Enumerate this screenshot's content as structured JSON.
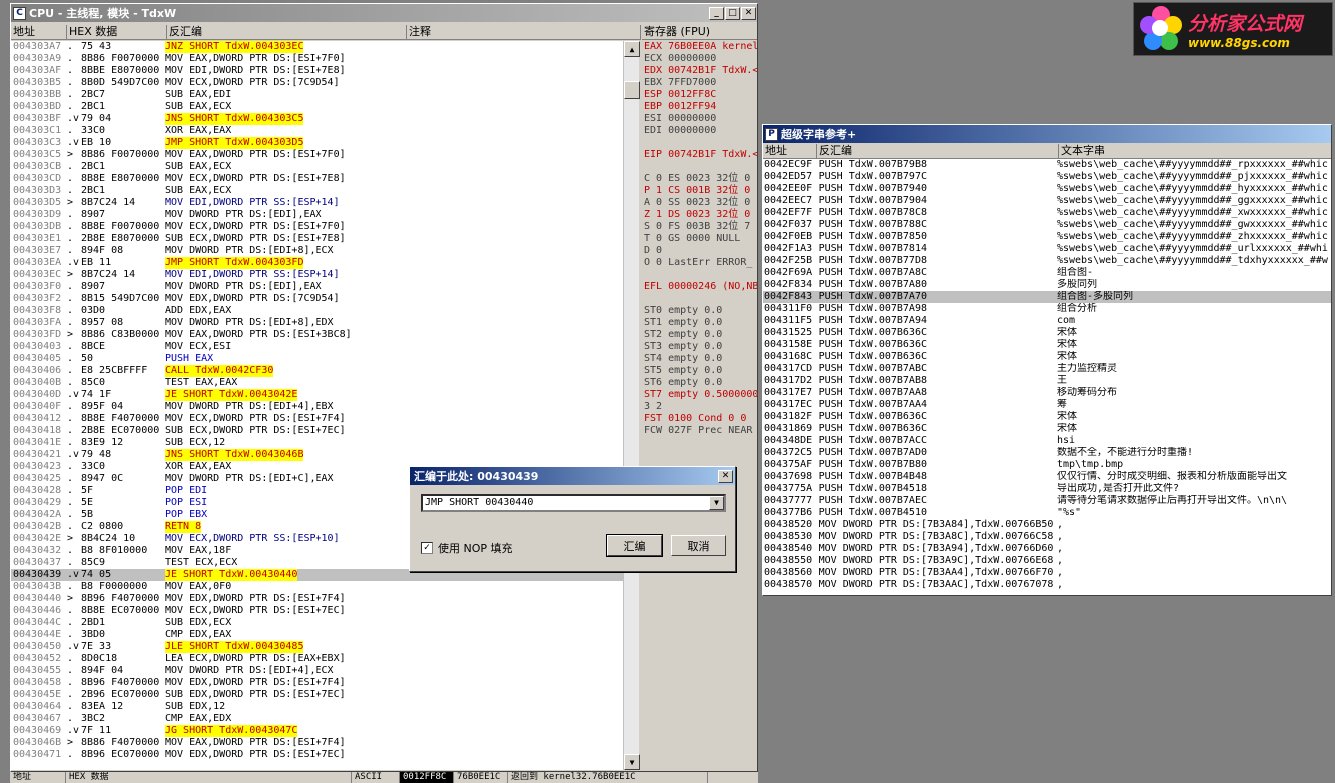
{
  "logo": {
    "title": "分析家公式网",
    "url_text": "www.88gs.com"
  },
  "cpu": {
    "title": "CPU - 主线程, 模块 - TdxW",
    "headers": {
      "addr": "地址",
      "hex": "HEX 数据",
      "disasm": "反汇编",
      "comment": "注释"
    },
    "rows": [
      {
        "a": "004303A7",
        "m": ".",
        "h": "75 43",
        "d": "JNZ SHORT TdxW.004303EC",
        "c": "y"
      },
      {
        "a": "004303A9",
        "m": ".",
        "h": "8B86 F0070000",
        "d": "MOV EAX,DWORD PTR DS:[ESI+7F0]",
        "c": "n"
      },
      {
        "a": "004303AF",
        "m": ".",
        "h": "8BBE E8070000",
        "d": "MOV EDI,DWORD PTR DS:[ESI+7E8]",
        "c": "n"
      },
      {
        "a": "004303B5",
        "m": ".",
        "h": "8B0D 549D7C00",
        "d": "MOV ECX,DWORD PTR DS:[7C9D54]",
        "c": "n"
      },
      {
        "a": "004303BB",
        "m": ".",
        "h": "2BC7",
        "d": "SUB EAX,EDI",
        "c": "n"
      },
      {
        "a": "004303BD",
        "m": ".",
        "h": "2BC1",
        "d": "SUB EAX,ECX",
        "c": "n"
      },
      {
        "a": "004303BF",
        "m": ".v",
        "h": "79 04",
        "d": "JNS SHORT TdxW.004303C5",
        "c": "y"
      },
      {
        "a": "004303C1",
        "m": ".",
        "h": "33C0",
        "d": "XOR EAX,EAX",
        "c": "n"
      },
      {
        "a": "004303C3",
        "m": ".v",
        "h": "EB 10",
        "d": "JMP SHORT TdxW.004303D5",
        "c": "y"
      },
      {
        "a": "004303C5",
        "m": ">",
        "h": "8B86 F0070000",
        "d": "MOV EAX,DWORD PTR DS:[ESI+7F0]",
        "c": "n"
      },
      {
        "a": "004303CB",
        "m": ".",
        "h": "2BC1",
        "d": "SUB EAX,ECX",
        "c": "n"
      },
      {
        "a": "004303CD",
        "m": ".",
        "h": "8B8E E8070000",
        "d": "MOV ECX,DWORD PTR DS:[ESI+7E8]",
        "c": "n"
      },
      {
        "a": "004303D3",
        "m": ".",
        "h": "2BC1",
        "d": "SUB EAX,ECX",
        "c": "n"
      },
      {
        "a": "004303D5",
        "m": ">",
        "h": "8B7C24 14",
        "d": "MOV EDI,DWORD PTR SS:[ESP+14]",
        "c": "s"
      },
      {
        "a": "004303D9",
        "m": ".",
        "h": "8907",
        "d": "MOV DWORD PTR DS:[EDI],EAX",
        "c": "n"
      },
      {
        "a": "004303DB",
        "m": ".",
        "h": "8B8E F0070000",
        "d": "MOV ECX,DWORD PTR DS:[ESI+7F0]",
        "c": "n"
      },
      {
        "a": "004303E1",
        "m": ".",
        "h": "2B8E E8070000",
        "d": "SUB ECX,DWORD PTR DS:[ESI+7E8]",
        "c": "n"
      },
      {
        "a": "004303E7",
        "m": ".",
        "h": "894F 08",
        "d": "MOV DWORD PTR DS:[EDI+8],ECX",
        "c": "n"
      },
      {
        "a": "004303EA",
        "m": ".v",
        "h": "EB 11",
        "d": "JMP SHORT TdxW.004303FD",
        "c": "y"
      },
      {
        "a": "004303EC",
        "m": ">",
        "h": "8B7C24 14",
        "d": "MOV EDI,DWORD PTR SS:[ESP+14]",
        "c": "s"
      },
      {
        "a": "004303F0",
        "m": ".",
        "h": "8907",
        "d": "MOV DWORD PTR DS:[EDI],EAX",
        "c": "n"
      },
      {
        "a": "004303F2",
        "m": ".",
        "h": "8B15 549D7C00",
        "d": "MOV EDX,DWORD PTR DS:[7C9D54]",
        "c": "n"
      },
      {
        "a": "004303F8",
        "m": ".",
        "h": "03D0",
        "d": "ADD EDX,EAX",
        "c": "n"
      },
      {
        "a": "004303FA",
        "m": ".",
        "h": "8957 08",
        "d": "MOV DWORD PTR DS:[EDI+8],EDX",
        "c": "n"
      },
      {
        "a": "004303FD",
        "m": ">",
        "h": "8B86 C83B0000",
        "d": "MOV EAX,DWORD PTR DS:[ESI+3BC8]",
        "c": "n"
      },
      {
        "a": "00430403",
        "m": ".",
        "h": "8BCE",
        "d": "MOV ECX,ESI",
        "c": "n"
      },
      {
        "a": "00430405",
        "m": ".",
        "h": "50",
        "d": "PUSH EAX",
        "c": "b"
      },
      {
        "a": "00430406",
        "m": ".",
        "h": "E8 25CBFFFF",
        "d": "CALL TdxW.0042CF30",
        "c": "y"
      },
      {
        "a": "0043040B",
        "m": ".",
        "h": "85C0",
        "d": "TEST EAX,EAX",
        "c": "n"
      },
      {
        "a": "0043040D",
        "m": ".v",
        "h": "74 1F",
        "d": "JE SHORT TdxW.0043042E",
        "c": "y"
      },
      {
        "a": "0043040F",
        "m": ".",
        "h": "895F 04",
        "d": "MOV DWORD PTR DS:[EDI+4],EBX",
        "c": "n"
      },
      {
        "a": "00430412",
        "m": ".",
        "h": "8B8E F4070000",
        "d": "MOV ECX,DWORD PTR DS:[ESI+7F4]",
        "c": "n"
      },
      {
        "a": "00430418",
        "m": ".",
        "h": "2B8E EC070000",
        "d": "SUB ECX,DWORD PTR DS:[ESI+7EC]",
        "c": "n"
      },
      {
        "a": "0043041E",
        "m": ".",
        "h": "83E9 12",
        "d": "SUB ECX,12",
        "c": "n"
      },
      {
        "a": "00430421",
        "m": ".v",
        "h": "79 48",
        "d": "JNS SHORT TdxW.0043046B",
        "c": "y"
      },
      {
        "a": "00430423",
        "m": ".",
        "h": "33C0",
        "d": "XOR EAX,EAX",
        "c": "n"
      },
      {
        "a": "00430425",
        "m": ".",
        "h": "8947 0C",
        "d": "MOV DWORD PTR DS:[EDI+C],EAX",
        "c": "n"
      },
      {
        "a": "00430428",
        "m": ".",
        "h": "5F",
        "d": "POP EDI",
        "c": "b"
      },
      {
        "a": "00430429",
        "m": ".",
        "h": "5E",
        "d": "POP ESI",
        "c": "b"
      },
      {
        "a": "0043042A",
        "m": ".",
        "h": "5B",
        "d": "POP EBX",
        "c": "b"
      },
      {
        "a": "0043042B",
        "m": ".",
        "h": "C2 0800",
        "d": "RETN 8",
        "c": "y"
      },
      {
        "a": "0043042E",
        "m": ">",
        "h": "8B4C24 10",
        "d": "MOV ECX,DWORD PTR SS:[ESP+10]",
        "c": "s"
      },
      {
        "a": "00430432",
        "m": ".",
        "h": "B8 8F010000",
        "d": "MOV EAX,18F",
        "c": "n"
      },
      {
        "a": "00430437",
        "m": ".",
        "h": "85C9",
        "d": "TEST ECX,ECX",
        "c": "n"
      },
      {
        "a": "00430439",
        "m": ".v",
        "h": "74 05",
        "d": "JE SHORT TdxW.00430440",
        "c": "y",
        "sel": true
      },
      {
        "a": "0043043B",
        "m": ".",
        "h": "B8 F0000000",
        "d": "MOV EAX,0F0",
        "c": "n"
      },
      {
        "a": "00430440",
        "m": ">",
        "h": "8B96 F4070000",
        "d": "MOV EDX,DWORD PTR DS:[ESI+7F4]",
        "c": "n"
      },
      {
        "a": "00430446",
        "m": ".",
        "h": "8B8E EC070000",
        "d": "MOV ECX,DWORD PTR DS:[ESI+7EC]",
        "c": "n"
      },
      {
        "a": "0043044C",
        "m": ".",
        "h": "2BD1",
        "d": "SUB EDX,ECX",
        "c": "n"
      },
      {
        "a": "0043044E",
        "m": ".",
        "h": "3BD0",
        "d": "CMP EDX,EAX",
        "c": "n"
      },
      {
        "a": "00430450",
        "m": ".v",
        "h": "7E 33",
        "d": "JLE SHORT TdxW.00430485",
        "c": "y"
      },
      {
        "a": "00430452",
        "m": ".",
        "h": "8D0C18",
        "d": "LEA ECX,DWORD PTR DS:[EAX+EBX]",
        "c": "n"
      },
      {
        "a": "00430455",
        "m": ".",
        "h": "894F 04",
        "d": "MOV DWORD PTR DS:[EDI+4],ECX",
        "c": "n"
      },
      {
        "a": "00430458",
        "m": ".",
        "h": "8B96 F4070000",
        "d": "MOV EDX,DWORD PTR DS:[ESI+7F4]",
        "c": "n"
      },
      {
        "a": "0043045E",
        "m": ".",
        "h": "2B96 EC070000",
        "d": "SUB EDX,DWORD PTR DS:[ESI+7EC]",
        "c": "n"
      },
      {
        "a": "00430464",
        "m": ".",
        "h": "83EA 12",
        "d": "SUB EDX,12",
        "c": "n"
      },
      {
        "a": "00430467",
        "m": ".",
        "h": "3BC2",
        "d": "CMP EAX,EDX",
        "c": "n"
      },
      {
        "a": "00430469",
        "m": ".v",
        "h": "7F 11",
        "d": "JG SHORT TdxW.0043047C",
        "c": "y"
      },
      {
        "a": "0043046B",
        "m": ">",
        "h": "8B86 F4070000",
        "d": "MOV EAX,DWORD PTR DS:[ESI+7F4]",
        "c": "n"
      },
      {
        "a": "00430471",
        "m": ".",
        "h": "8B96 EC070000",
        "d": "MOV EDX,DWORD PTR DS:[ESI+7EC]",
        "c": "n"
      }
    ]
  },
  "registers": {
    "header": "寄存器 (FPU)",
    "lines": [
      {
        "t": "EAX 76B0EE0A kernel",
        "r": true
      },
      {
        "t": "ECX 00000000",
        "r": false
      },
      {
        "t": "EDX 00742B1F TdxW.<",
        "r": true
      },
      {
        "t": "EBX 7FFD7000",
        "r": false
      },
      {
        "t": "ESP 0012FF8C",
        "r": true
      },
      {
        "t": "EBP 0012FF94",
        "r": true
      },
      {
        "t": "ESI 00000000",
        "r": false
      },
      {
        "t": "EDI 00000000",
        "r": false
      },
      {
        "t": "",
        "r": false
      },
      {
        "t": "EIP 00742B1F TdxW.<",
        "r": true
      },
      {
        "t": "",
        "r": false
      },
      {
        "t": "C 0  ES 0023 32位 0",
        "r": false
      },
      {
        "t": "P 1  CS 001B 32位 0",
        "r": true
      },
      {
        "t": "A 0  SS 0023 32位 0",
        "r": false
      },
      {
        "t": "Z 1  DS 0023 32位 0",
        "r": true
      },
      {
        "t": "S 0  FS 003B 32位 7",
        "r": false
      },
      {
        "t": "T 0  GS 0000 NULL",
        "r": false
      },
      {
        "t": "D 0",
        "r": false
      },
      {
        "t": "O 0  LastErr ERROR_",
        "r": false
      },
      {
        "t": "",
        "r": false
      },
      {
        "t": "EFL 00000246 (NO,NB",
        "r": true
      },
      {
        "t": "",
        "r": false
      },
      {
        "t": "ST0 empty 0.0",
        "r": false
      },
      {
        "t": "ST1 empty 0.0",
        "r": false
      },
      {
        "t": "ST2 empty 0.0",
        "r": false
      },
      {
        "t": "ST3 empty 0.0",
        "r": false
      },
      {
        "t": "ST4 empty 0.0",
        "r": false
      },
      {
        "t": "ST5 empty 0.0",
        "r": false
      },
      {
        "t": "ST6 empty 0.0",
        "r": false
      },
      {
        "t": "ST7 empty 0.5000000",
        "r": true
      },
      {
        "t": "               3 2",
        "r": false
      },
      {
        "t": "FST 0100  Cond 0 0",
        "r": true
      },
      {
        "t": "FCW 027F  Prec NEAR",
        "r": false
      }
    ]
  },
  "strings": {
    "title": "超级字串参考+",
    "headers": {
      "addr": "地址",
      "disasm": "反汇编",
      "text": "文本字串"
    },
    "rows": [
      {
        "a": "0042EC9F",
        "d": "PUSH TdxW.007B79B8",
        "t": "%swebs\\web_cache\\##yyyymmdd##_rpxxxxxx_##whic"
      },
      {
        "a": "0042ED57",
        "d": "PUSH TdxW.007B797C",
        "t": "%swebs\\web_cache\\##yyyymmdd##_pjxxxxxx_##whic"
      },
      {
        "a": "0042EE0F",
        "d": "PUSH TdxW.007B7940",
        "t": "%swebs\\web_cache\\##yyyymmdd##_hyxxxxxx_##whic"
      },
      {
        "a": "0042EEC7",
        "d": "PUSH TdxW.007B7904",
        "t": "%swebs\\web_cache\\##yyyymmdd##_ggxxxxxx_##whic"
      },
      {
        "a": "0042EF7F",
        "d": "PUSH TdxW.007B78C8",
        "t": "%swebs\\web_cache\\##yyyymmdd##_xwxxxxxx_##whic"
      },
      {
        "a": "0042F037",
        "d": "PUSH TdxW.007B788C",
        "t": "%swebs\\web_cache\\##yyyymmdd##_gwxxxxxx_##whic"
      },
      {
        "a": "0042F0EB",
        "d": "PUSH TdxW.007B7850",
        "t": "%swebs\\web_cache\\##yyyymmdd##_zhxxxxxx_##whic"
      },
      {
        "a": "0042F1A3",
        "d": "PUSH TdxW.007B7814",
        "t": "%swebs\\web_cache\\##yyyymmdd##_urlxxxxxx_##whi"
      },
      {
        "a": "0042F25B",
        "d": "PUSH TdxW.007B77D8",
        "t": "%swebs\\web_cache\\##yyyymmdd##_tdxhyxxxxxx_##w"
      },
      {
        "a": "0042F69A",
        "d": "PUSH TdxW.007B7A8C",
        "t": "组合图-"
      },
      {
        "a": "0042F834",
        "d": "PUSH TdxW.007B7A80",
        "t": "多股同列"
      },
      {
        "a": "0042F843",
        "d": "PUSH TdxW.007B7A70",
        "t": "组合图-多股同列",
        "sel": true
      },
      {
        "a": "004311F0",
        "d": "PUSH TdxW.007B7A98",
        "t": "组合分析"
      },
      {
        "a": "004311F5",
        "d": "PUSH TdxW.007B7A94",
        "t": "com"
      },
      {
        "a": "00431525",
        "d": "PUSH TdxW.007B636C",
        "t": "宋体"
      },
      {
        "a": "0043158E",
        "d": "PUSH TdxW.007B636C",
        "t": "宋体"
      },
      {
        "a": "0043168C",
        "d": "PUSH TdxW.007B636C",
        "t": "宋体"
      },
      {
        "a": "004317CD",
        "d": "PUSH TdxW.007B7ABC",
        "t": "主力监控精灵"
      },
      {
        "a": "004317D2",
        "d": "PUSH TdxW.007B7AB8",
        "t": "王"
      },
      {
        "a": "004317E7",
        "d": "PUSH TdxW.007B7AA8",
        "t": "移动筹码分布"
      },
      {
        "a": "004317EC",
        "d": "PUSH TdxW.007B7AA4",
        "t": "筹"
      },
      {
        "a": "0043182F",
        "d": "PUSH TdxW.007B636C",
        "t": "宋体"
      },
      {
        "a": "00431869",
        "d": "PUSH TdxW.007B636C",
        "t": "宋体"
      },
      {
        "a": "004348DE",
        "d": "PUSH TdxW.007B7ACC",
        "t": "hsi"
      },
      {
        "a": "004372C5",
        "d": "PUSH TdxW.007B7AD0",
        "t": "数据不全，不能进行分时重播!"
      },
      {
        "a": "004375AF",
        "d": "PUSH TdxW.007B7B80",
        "t": "tmp\\tmp.bmp"
      },
      {
        "a": "00437698",
        "d": "PUSH TdxW.007B4B48",
        "t": "仅仅行情、分时成交明细、报表和分析版面能导出文"
      },
      {
        "a": "0043775A",
        "d": "PUSH TdxW.007B4518",
        "t": "导出成功,是否打开此文件?"
      },
      {
        "a": "00437777",
        "d": "PUSH TdxW.007B7AEC",
        "t": "请等待分笔请求数据停止后再打开导出文件。\\n\\n\\"
      },
      {
        "a": "004377B6",
        "d": "PUSH TdxW.007B4510",
        "t": "\"%s\""
      },
      {
        "a": "00438520",
        "d": "MOV DWORD PTR DS:[7B3A84],TdxW.00766B50",
        "t": ","
      },
      {
        "a": "00438530",
        "d": "MOV DWORD PTR DS:[7B3A8C],TdxW.00766C58",
        "t": ","
      },
      {
        "a": "00438540",
        "d": "MOV DWORD PTR DS:[7B3A94],TdxW.00766D60",
        "t": ","
      },
      {
        "a": "00438550",
        "d": "MOV DWORD PTR DS:[7B3A9C],TdxW.00766E68",
        "t": ","
      },
      {
        "a": "00438560",
        "d": "MOV DWORD PTR DS:[7B3AA4],TdxW.00766F70",
        "t": ","
      },
      {
        "a": "00438570",
        "d": "MOV DWORD PTR DS:[7B3AAC],TdxW.00767078",
        "t": ","
      }
    ]
  },
  "dialog": {
    "title": "汇编于此处: 00430439",
    "input_value": "JMP SHORT 00430440",
    "checkbox_label": "使用 NOP 填充",
    "checkbox_checked": "✓",
    "assemble_label": "汇编",
    "cancel_label": "取消"
  },
  "statusbar": {
    "addr": "地址",
    "hex": "HEX 数据",
    "ascii": "ASCII",
    "esp": "0012FF8C",
    "val": "76B0EE1C",
    "ret": "返回到 kernel32.76B0EE1C"
  }
}
